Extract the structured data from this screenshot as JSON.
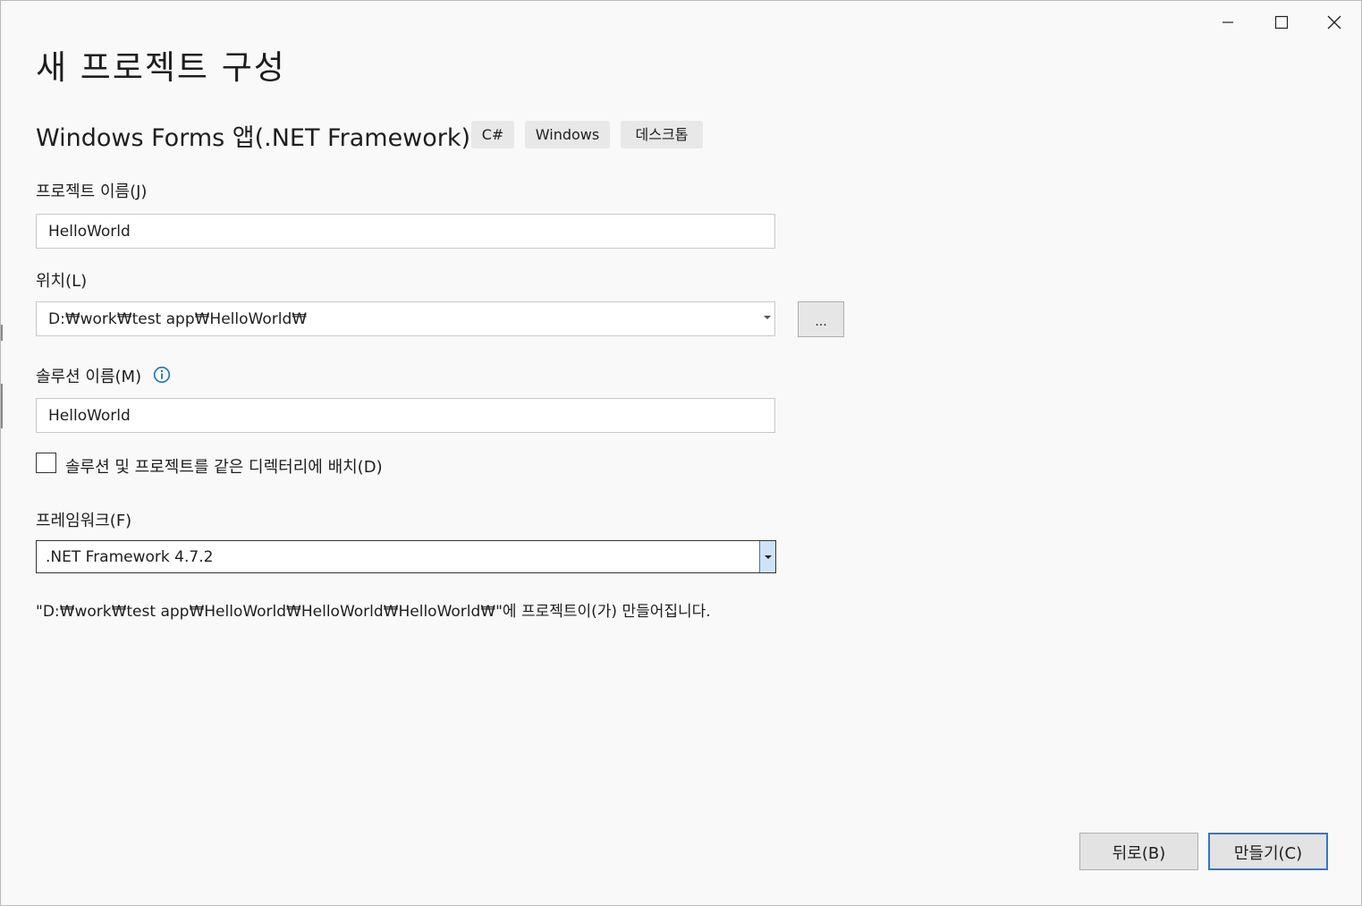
{
  "window": {
    "controls": {
      "minimize_icon": "minimize-icon",
      "maximize_icon": "maximize-icon",
      "close_icon": "close-icon"
    }
  },
  "header": {
    "title": "새 프로젝트 구성",
    "template_name": "Windows Forms 앱(.NET Framework)",
    "tags": [
      "C#",
      "Windows",
      "데스크톱"
    ]
  },
  "form": {
    "project_name": {
      "label": "프로젝트 이름(J)",
      "value": "HelloWorld"
    },
    "location": {
      "label": "위치(L)",
      "value": "D:₩work₩test app₩HelloWorld₩",
      "browse_label": "..."
    },
    "solution_name": {
      "label": "솔루션 이름(M)",
      "value": "HelloWorld",
      "info_icon": "info-icon"
    },
    "same_directory": {
      "label": "솔루션 및 프로젝트를 같은 디렉터리에 배치(D)",
      "checked": false
    },
    "framework": {
      "label": "프레임워크(F)",
      "value": ".NET Framework 4.7.2"
    }
  },
  "output_note": "\"D:₩work₩test app₩HelloWorld₩HelloWorld₩HelloWorld₩\"에 프로젝트이(가) 만들어집니다.",
  "footer": {
    "back_label": "뒤로(B)",
    "create_label": "만들기(C)"
  },
  "colors": {
    "accent": "#2b78d4",
    "info": "#1a73b8"
  }
}
